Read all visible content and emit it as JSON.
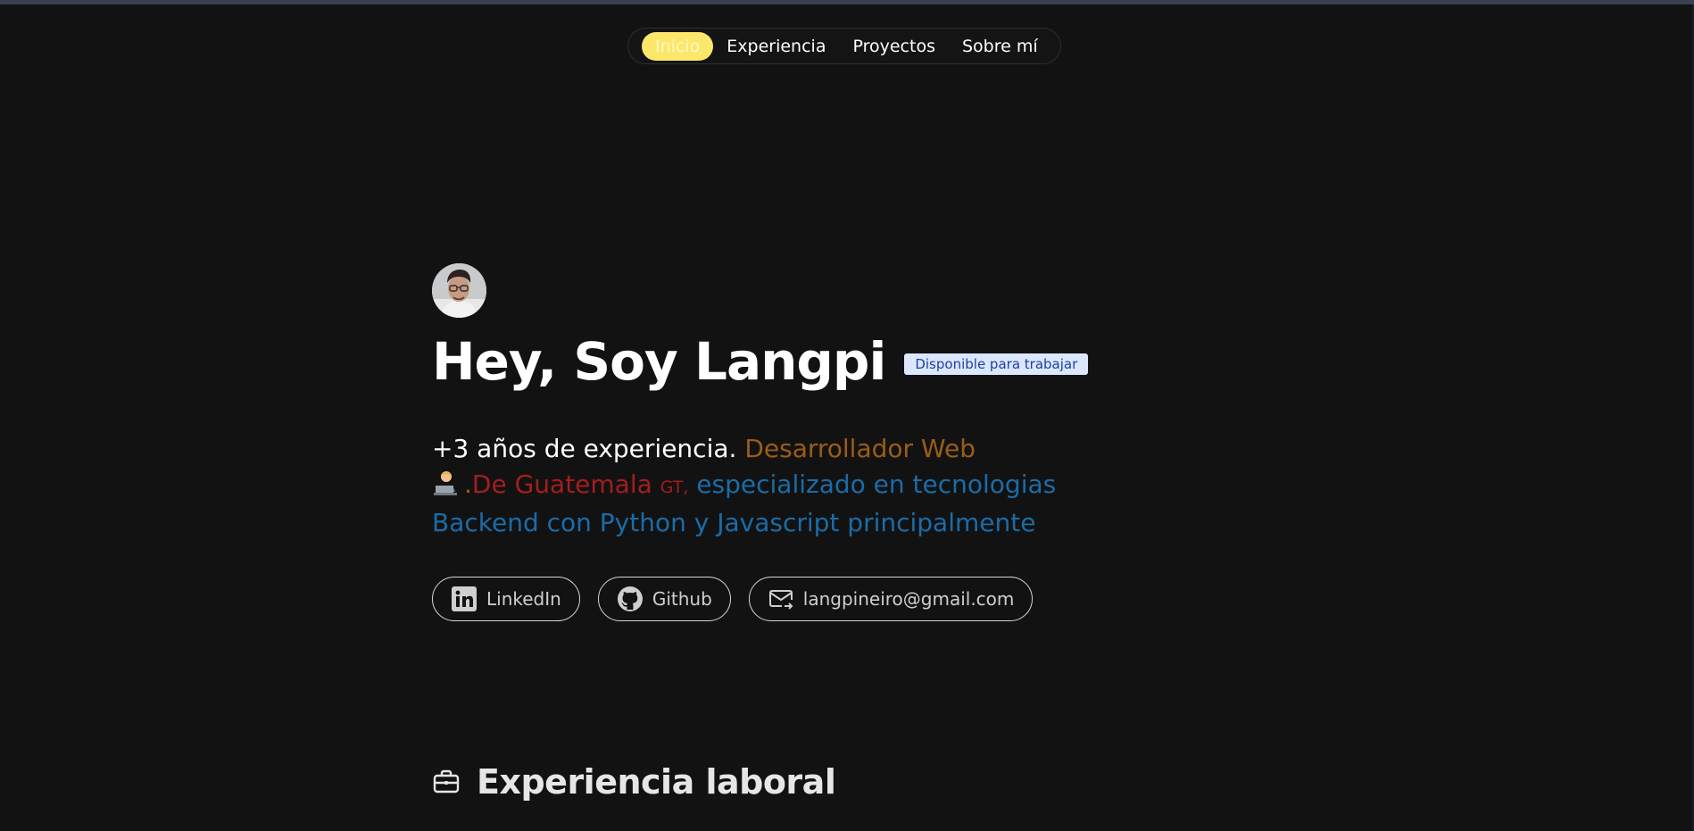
{
  "nav": {
    "items": [
      {
        "label": "Inicio",
        "active": true
      },
      {
        "label": "Experiencia",
        "active": false
      },
      {
        "label": "Proyectos",
        "active": false
      },
      {
        "label": "Sobre mí",
        "active": false
      }
    ]
  },
  "hero": {
    "title": "Hey, Soy Langpi",
    "badge": "Disponible para trabajar",
    "bio": {
      "lead": "+3 años de experiencia.",
      "role": "Desarrollador Web",
      "dot": ".",
      "country": "De Guatemala",
      "country_code": "GT,",
      "specialty": "especializado en tecnologias Backend con Python y Javascript principalmente"
    }
  },
  "socials": [
    {
      "label": "LinkedIn",
      "icon": "linkedin-icon"
    },
    {
      "label": "Github",
      "icon": "github-icon"
    },
    {
      "label": "langpineiro@gmail.com",
      "icon": "mail-icon"
    }
  ],
  "sections": {
    "experience_title": "Experiencia laboral",
    "experience_icon": "briefcase-icon"
  },
  "colors": {
    "background": "#121212",
    "accent_active_tab": "#fce76a",
    "role": "#9a5d18",
    "country": "#a51d1d",
    "specialty": "#1a6ca8",
    "badge_bg": "#dbe7fc"
  }
}
